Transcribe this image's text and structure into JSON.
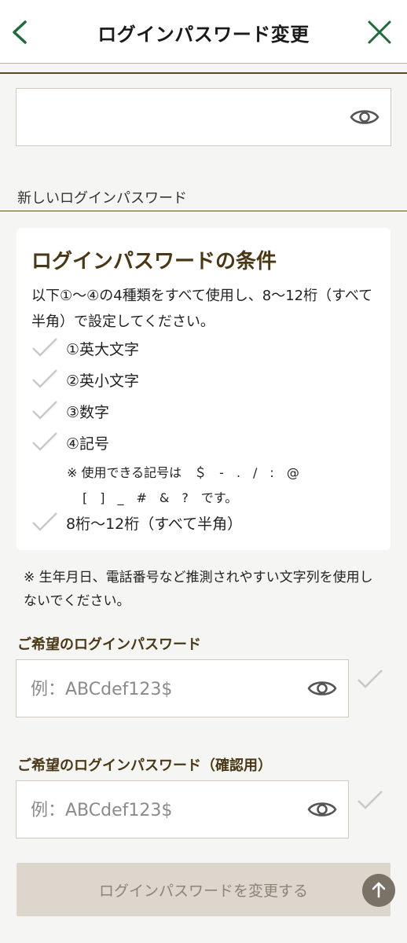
{
  "header": {
    "title": "ログインパスワード変更",
    "accent_color": "#1e6b3c",
    "back_icon": "chevron-left-icon",
    "close_icon": "close-icon"
  },
  "current_password": {
    "value": "",
    "eye_icon": "eye-icon"
  },
  "new_section": {
    "label": "新しいログインパスワード"
  },
  "conditions": {
    "title": "ログインパスワードの条件",
    "description": "以下①〜④の4種類をすべて使用し、8〜12桁（すべて半角）で設定してください。",
    "items": [
      {
        "label": "①英大文字"
      },
      {
        "label": "②英小文字"
      },
      {
        "label": "③数字"
      },
      {
        "label": "④記号"
      }
    ],
    "symbols_line1": "※ 使用できる記号は　＄　-　.　/　:　@",
    "symbols_line2": "[　]　_　#　&　?　です。",
    "length_item": "8桁〜12桁（すべて半角）"
  },
  "warning": "※ 生年月日、電話番号など推測されやすい文字列を使用しないでください。",
  "desired_password": {
    "label": "ご希望のログインパスワード",
    "placeholder": "例：ABCdef123$",
    "value": ""
  },
  "confirm_password": {
    "label": "ご希望のログインパスワード（確認用）",
    "placeholder": "例：ABCdef123$",
    "value": ""
  },
  "submit": {
    "label": "ログインパスワードを変更する"
  },
  "scroll_top_icon": "arrow-up-icon"
}
